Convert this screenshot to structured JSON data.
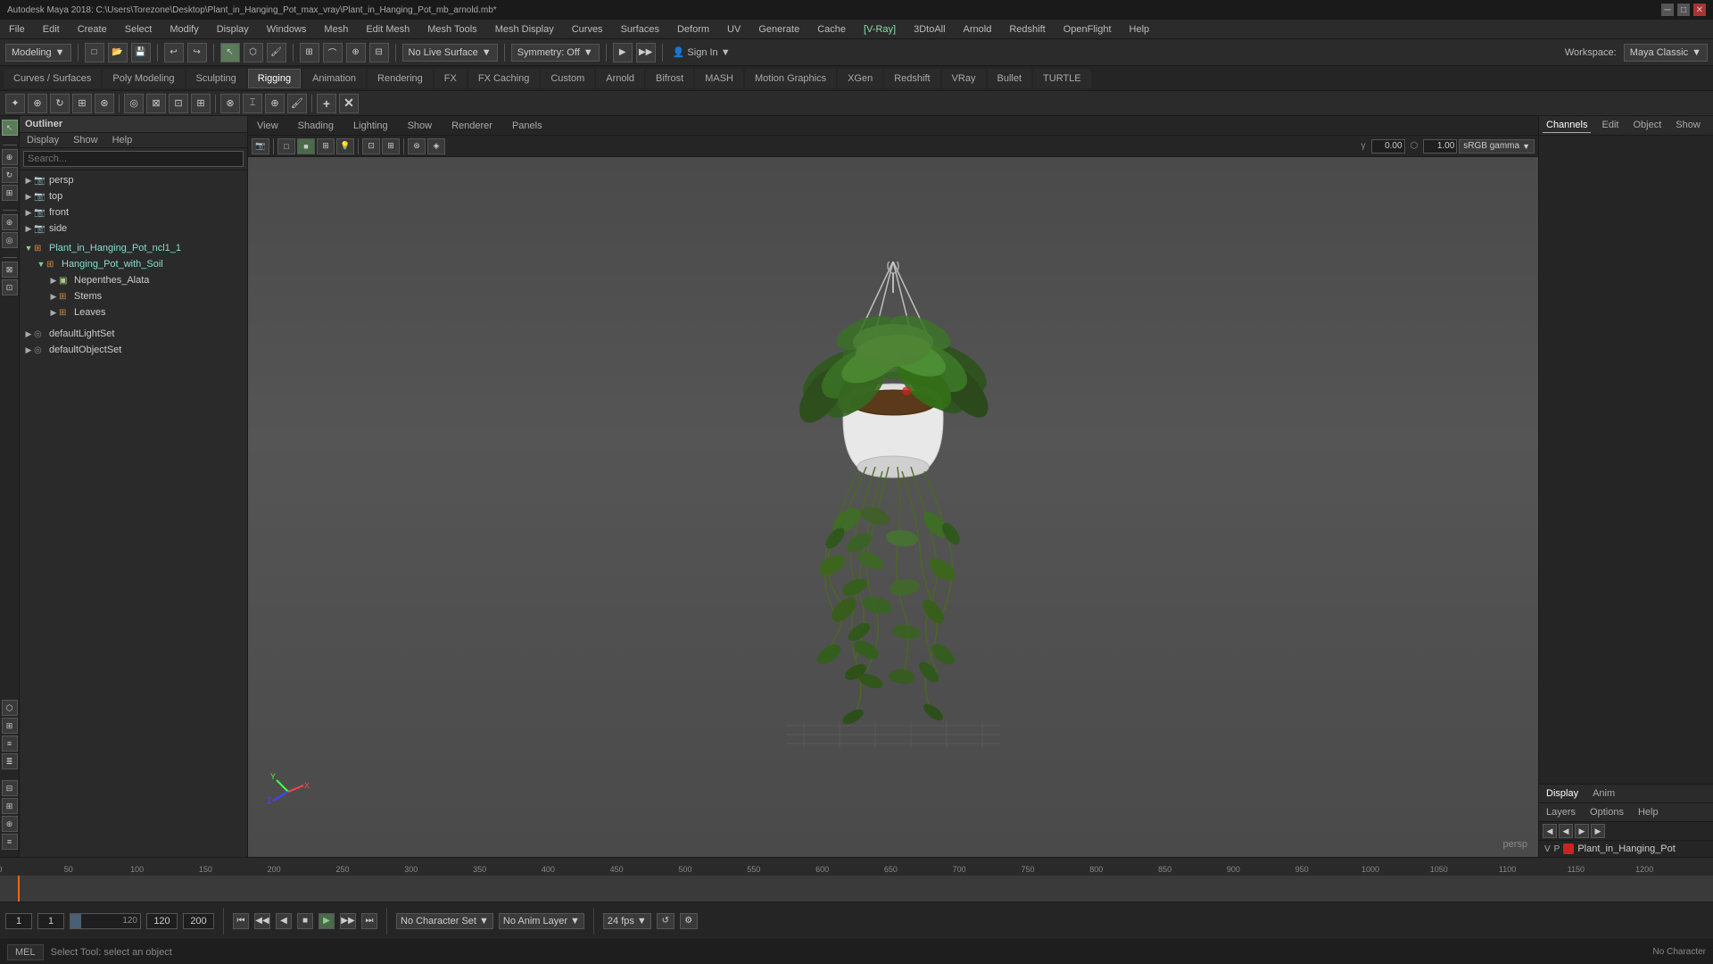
{
  "window": {
    "title": "Autodesk Maya 2018: C:\\Users\\Torezone\\Desktop\\Plant_in_Hanging_Pot_max_vray\\Plant_in_Hanging_Pot_mb_arnold.mb*"
  },
  "menu_bar": {
    "items": [
      "File",
      "Edit",
      "Create",
      "Select",
      "Modify",
      "Display",
      "Windows",
      "Mesh",
      "Edit Mesh",
      "Mesh Tools",
      "Mesh Display",
      "Curves",
      "Surfaces",
      "Deform",
      "UV",
      "Generate",
      "Cache",
      "V-Ray",
      "3DtoAll",
      "Arnold",
      "Redshift",
      "OpenFlight",
      "Help"
    ]
  },
  "toolbar1": {
    "workspace_label": "Workspace:",
    "workspace_value": "Maya Classic",
    "mode_label": "Modeling"
  },
  "mode_tabs": {
    "items": [
      "Curves / Surfaces",
      "Poly Modeling",
      "Sculpting",
      "Rigging",
      "Animation",
      "Rendering",
      "FX",
      "FX Caching",
      "Custom",
      "Arnold",
      "Bifrost",
      "MASH",
      "Motion Graphics",
      "XGen",
      "Redshift",
      "VRay",
      "Bullet",
      "TURTLE"
    ],
    "active": "Rigging"
  },
  "viewport_menu": {
    "items": [
      "View",
      "Shading",
      "Lighting",
      "Show",
      "Renderer",
      "Panels"
    ]
  },
  "viewport": {
    "live_surface": "No Live Surface",
    "symmetry": "Symmetry: Off",
    "camera_label": "persp",
    "gamma_value": "0.00",
    "exposure_value": "1.00",
    "colorspace": "sRGB gamma"
  },
  "outliner": {
    "title": "Outliner",
    "menu_items": [
      "Display",
      "Show",
      "Help"
    ],
    "search_placeholder": "Search...",
    "tree": [
      {
        "id": "persp",
        "label": "persp",
        "type": "camera",
        "indent": 0,
        "expanded": false
      },
      {
        "id": "top",
        "label": "top",
        "type": "camera",
        "indent": 0,
        "expanded": false
      },
      {
        "id": "front",
        "label": "front",
        "type": "camera",
        "indent": 0,
        "expanded": false
      },
      {
        "id": "side",
        "label": "side",
        "type": "camera",
        "indent": 0,
        "expanded": false
      },
      {
        "id": "plant_root",
        "label": "Plant_in_Hanging_Pot_ncl1_1",
        "type": "group",
        "indent": 0,
        "expanded": true
      },
      {
        "id": "hanging_pot",
        "label": "Hanging_Pot_with_Soil",
        "type": "group",
        "indent": 1,
        "expanded": true
      },
      {
        "id": "nepenthes",
        "label": "Nepenthes_Alata",
        "type": "mesh",
        "indent": 2,
        "expanded": false
      },
      {
        "id": "stems",
        "label": "Stems",
        "type": "group",
        "indent": 2,
        "expanded": false
      },
      {
        "id": "leaves",
        "label": "Leaves",
        "type": "group",
        "indent": 2,
        "expanded": false
      },
      {
        "id": "defaultLightSet",
        "label": "defaultLightSet",
        "type": "set",
        "indent": 0,
        "expanded": false
      },
      {
        "id": "defaultObjectSet",
        "label": "defaultObjectSet",
        "type": "set",
        "indent": 0,
        "expanded": false
      }
    ]
  },
  "right_panel": {
    "tabs": [
      "Channels",
      "Edit",
      "Object",
      "Show"
    ],
    "active_tab": "Channels"
  },
  "layers_panel": {
    "tabs": [
      "Display",
      "Anim"
    ],
    "active_tab": "Display",
    "menu_items": [
      "Layers",
      "Options",
      "Help"
    ],
    "layer": {
      "v_label": "V",
      "p_label": "P",
      "name": "Plant_in_Hanging_Pot",
      "color": "#cc2222"
    }
  },
  "timeline": {
    "start": "1",
    "current": "1",
    "end_range": "120",
    "total_end": "200",
    "playback_speed": "24 fps",
    "marks": [
      0,
      50,
      100,
      150,
      200,
      250,
      300,
      350,
      400,
      450,
      500,
      550,
      600,
      650,
      700,
      750,
      800,
      850,
      900,
      950,
      1000,
      1050,
      1100,
      1150,
      1200
    ],
    "ruler_labels": [
      "0",
      "50",
      "100",
      "150",
      "200",
      "250",
      "300",
      "350",
      "400",
      "450",
      "500",
      "550",
      "600",
      "650",
      "700",
      "750",
      "800",
      "850",
      "900",
      "950",
      "1000",
      "1050",
      "1100",
      "1150",
      "1200"
    ]
  },
  "bottom_controls": {
    "frame_start": "1",
    "frame_current": "1",
    "range_end": "120",
    "total_end": "200",
    "character_set": "No Character Set",
    "anim_layer": "No Anim Layer",
    "fps": "24 fps",
    "play_buttons": [
      "⏮",
      "⏭",
      "◀",
      "▶",
      "▶",
      "⏭",
      "⏮",
      "▶▶"
    ]
  },
  "status_bar": {
    "text": "Select Tool: select an object"
  },
  "footer": {
    "language": "MEL",
    "no_character": "No Character"
  }
}
